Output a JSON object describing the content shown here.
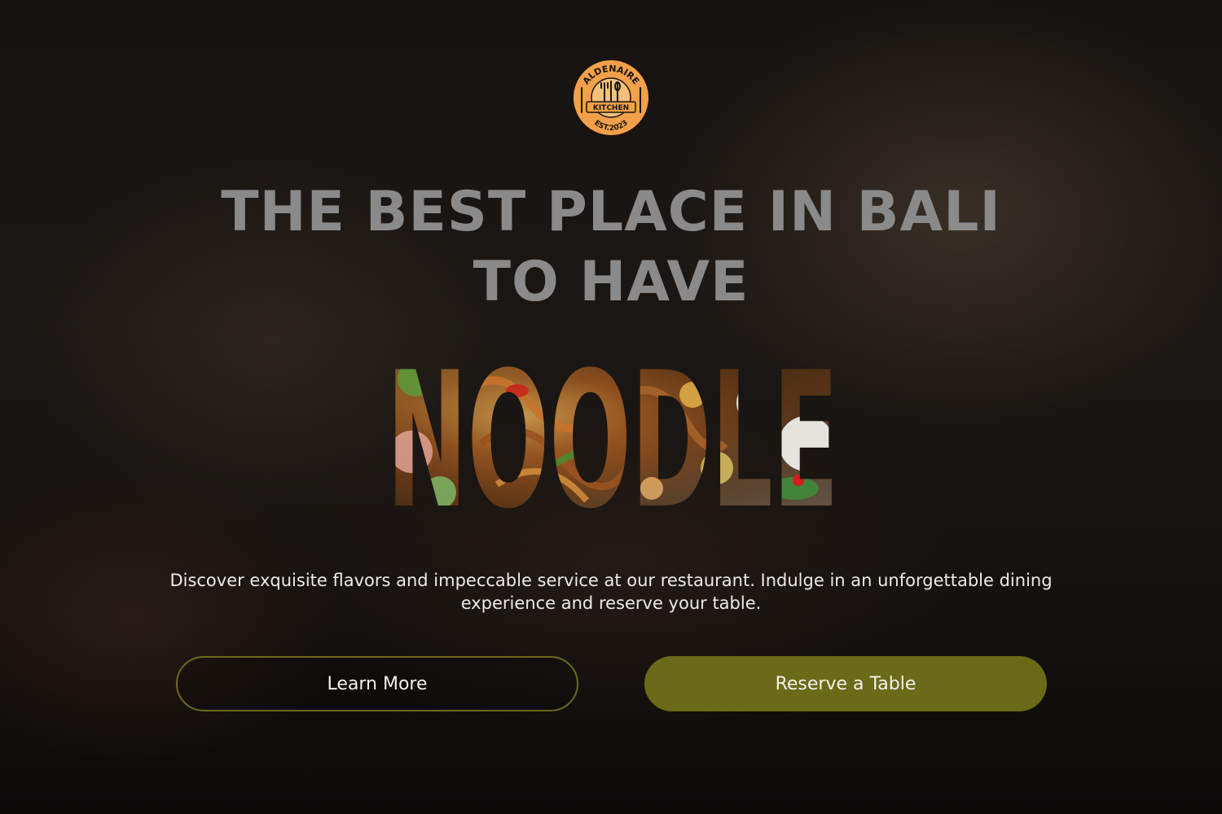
{
  "logo": {
    "name_top": "ALDENAIRE",
    "name_banner": "KITCHEN",
    "established": "EST.2023"
  },
  "hero": {
    "headline_line1": "THE BEST PLACE IN BALI",
    "headline_line2": "TO HAVE",
    "highlight_word": "NOODLE",
    "description": "Discover exquisite flavors and impeccable service at our restaurant. Indulge in an unforgettable dining experience and reserve your table."
  },
  "buttons": {
    "learn_more": "Learn More",
    "reserve": "Reserve a Table"
  },
  "colors": {
    "accent": "#6a6a18",
    "logo_orange": "#f2a04a",
    "headline_gray": "#8a8a8a"
  }
}
